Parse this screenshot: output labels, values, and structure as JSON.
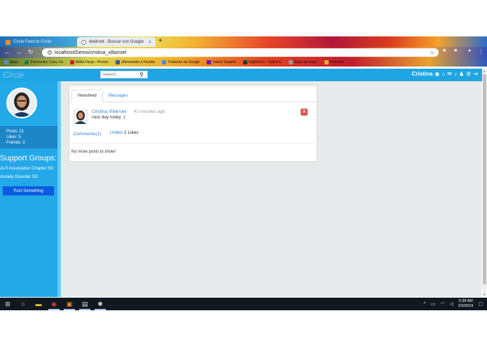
{
  "browser": {
    "tabs": [
      {
        "label": "Circle Feed to Circle",
        "active": false
      },
      {
        "label": "deidroot - Buscar con Google",
        "active": true
      }
    ],
    "new_tab_symbol": "+",
    "close_symbol": "×",
    "url": "localhost/Demo/cristina_villarroel",
    "bookmarks": [
      {
        "label": "Apps",
        "color": "#5f88d8"
      },
      {
        "label": "Electronics, Cars, Fa",
        "color": "#2a7a3a"
      },
      {
        "label": "Wells Fargo - Person",
        "color": "#c0262c"
      },
      {
        "label": "¡Bienvenido a Facebo",
        "color": "#3b5998"
      },
      {
        "label": "Traductor de Google",
        "color": "#4a8af0"
      },
      {
        "label": "Yahoo! España",
        "color": "#6a1aa8"
      },
      {
        "label": "NightDevs - Twitch.tv",
        "color": "#333333"
      },
      {
        "label": "Ropa de mujer",
        "color": "#999999"
      },
      {
        "label": "Pinterest",
        "color": "#e0b030"
      }
    ]
  },
  "app": {
    "brand": "Circle",
    "search_placeholder": "Search...",
    "username": "Cristina",
    "nav_icons": [
      "camera-icon",
      "home-icon",
      "envelope-icon",
      "bell-icon",
      "users-icon",
      "gear-icon",
      "logout-icon"
    ]
  },
  "sidebar": {
    "stats": {
      "posts": "Posts: 21",
      "likes": "Likes: 5",
      "friends": "Friends: 2"
    },
    "groups_title": "Support Groups:",
    "groups": [
      "ALS Association Chapter SG",
      "Anxiety Disorder SG"
    ],
    "post_button": "Post Something"
  },
  "feed": {
    "tabs": [
      "Newsfeed",
      "Messages"
    ],
    "posts": [
      {
        "author": "Cristina Villarroel",
        "time": "42 minutes ago",
        "text": "nice day today :)",
        "delete_label": "X",
        "comments": "Comments(1)",
        "unlike": "Unlike",
        "likes": "2 Likes"
      }
    ],
    "end_text": "No more posts to show!"
  },
  "taskbar": {
    "clock_time": "5:38 AM",
    "clock_date": "2/3/2019"
  },
  "colors": {
    "app_bar": "#1fa5e3",
    "sidebar": "#23a8e8",
    "stats_band": "#1d86c7",
    "post_button": "#0a5be0",
    "link": "#2a7fd6",
    "delete": "#d9534f"
  }
}
